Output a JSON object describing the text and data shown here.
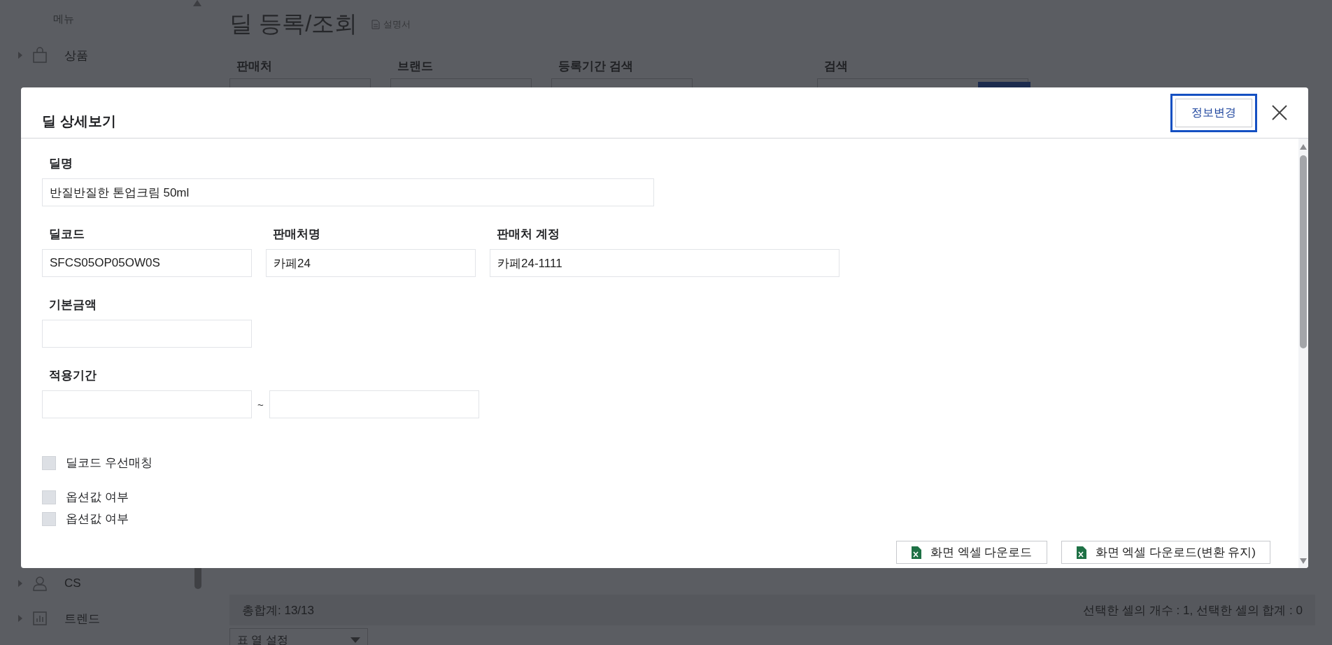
{
  "sidebar": {
    "title": "메뉴",
    "items": [
      {
        "label": "상품"
      },
      {
        "label": "CS"
      },
      {
        "label": "트렌드"
      }
    ]
  },
  "page": {
    "title": "딜 등록/조회",
    "manual_link": "설명서",
    "filters": [
      "판매처",
      "브랜드",
      "등록기간 검색",
      "검색"
    ],
    "total": "총합계: 13/13",
    "selection_summary": "선택한 셀의 개수 : 1, 선택한 셀의 합계 : 0",
    "column_settings": "표 열 설정"
  },
  "modal": {
    "title": "딜 상세보기",
    "edit_button": "정보변경",
    "deal_name": {
      "label": "딜명",
      "value": "반질반질한 톤업크림 50ml"
    },
    "info_row": [
      {
        "label": "딜코드",
        "value": "SFCS05OP05OW0S"
      },
      {
        "label": "판매처명",
        "value": "카페24"
      },
      {
        "label": "판매처 계정",
        "value": "카페24-1111"
      }
    ],
    "base_price": {
      "label": "기본금액"
    },
    "period": {
      "label": "적용기간",
      "separator": "~"
    },
    "checkboxes": [
      {
        "label": "딜코드 우선매칭",
        "checked": false
      },
      {
        "label": "옵션값 여부",
        "checked": false
      },
      {
        "label": "옵션값 여부",
        "checked": false
      }
    ],
    "download_buttons": [
      "화면 엑셀 다운로드",
      "화면 엑셀 다운로드(변환 유지)"
    ]
  }
}
